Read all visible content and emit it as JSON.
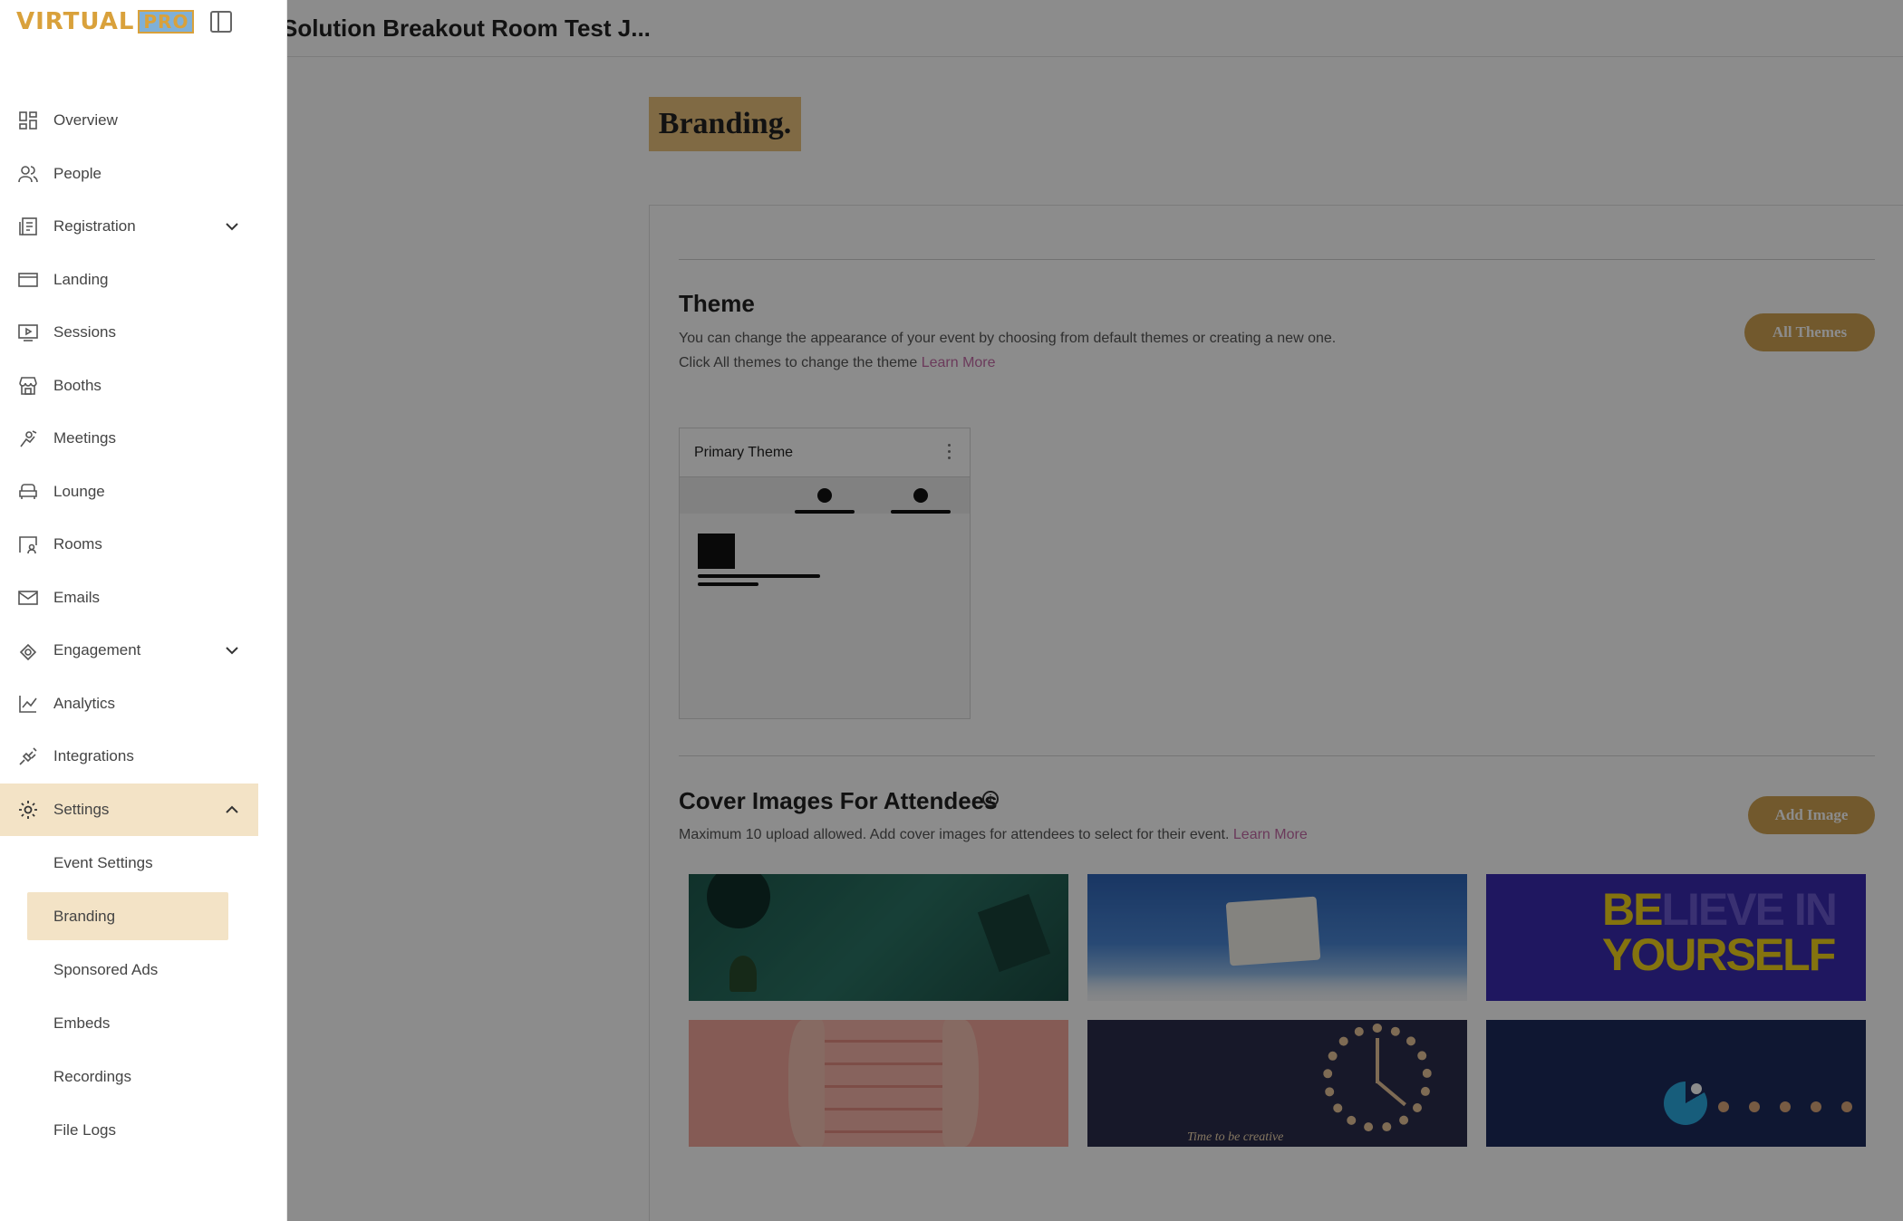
{
  "app": {
    "logo_word": "VIRTUAL",
    "logo_badge": "PRO"
  },
  "header": {
    "title": "Solution Breakout Room Test J..."
  },
  "sidebar": {
    "items": [
      {
        "label": "Overview",
        "icon": "grid-icon"
      },
      {
        "label": "People",
        "icon": "users-icon"
      },
      {
        "label": "Registration",
        "icon": "registration-icon",
        "expandable": true
      },
      {
        "label": "Landing",
        "icon": "landing-icon"
      },
      {
        "label": "Sessions",
        "icon": "sessions-icon"
      },
      {
        "label": "Booths",
        "icon": "store-icon"
      },
      {
        "label": "Meetings",
        "icon": "handshake-icon"
      },
      {
        "label": "Lounge",
        "icon": "sofa-icon"
      },
      {
        "label": "Rooms",
        "icon": "rooms-icon"
      },
      {
        "label": "Emails",
        "icon": "mail-icon"
      },
      {
        "label": "Engagement",
        "icon": "engagement-icon",
        "expandable": true
      },
      {
        "label": "Analytics",
        "icon": "chart-line-icon"
      },
      {
        "label": "Integrations",
        "icon": "plug-icon"
      },
      {
        "label": "Settings",
        "icon": "gear-icon",
        "expanded": true,
        "active": true
      }
    ],
    "settings_sub": [
      {
        "label": "Event Settings"
      },
      {
        "label": "Branding",
        "active": true
      },
      {
        "label": "Sponsored Ads"
      },
      {
        "label": "Embeds"
      },
      {
        "label": "Recordings"
      },
      {
        "label": "File Logs"
      }
    ]
  },
  "page": {
    "heading": "Branding.",
    "theme": {
      "title": "Theme",
      "desc_line1": "You can change the appearance of your event by choosing from default themes or creating a new one.",
      "desc_line2": "Click All themes to change the theme",
      "learn_more": "Learn More",
      "all_themes_button": "All Themes",
      "card_title": "Primary Theme"
    },
    "cover": {
      "title": "Cover Images For Attendees",
      "desc": "Maximum 10 upload allowed. Add cover images for attendees to select for their event.",
      "learn_more": "Learn More",
      "add_button": "Add Image",
      "image3_text_bright": "BE",
      "image3_text_dim": "LIEVE IN",
      "image3_line2": "YOURSELF",
      "image5_caption": "Time to be creative"
    }
  },
  "colors": {
    "accent": "#cfa353",
    "active_bg": "#f3e3c6",
    "link": "#c46aa6"
  }
}
